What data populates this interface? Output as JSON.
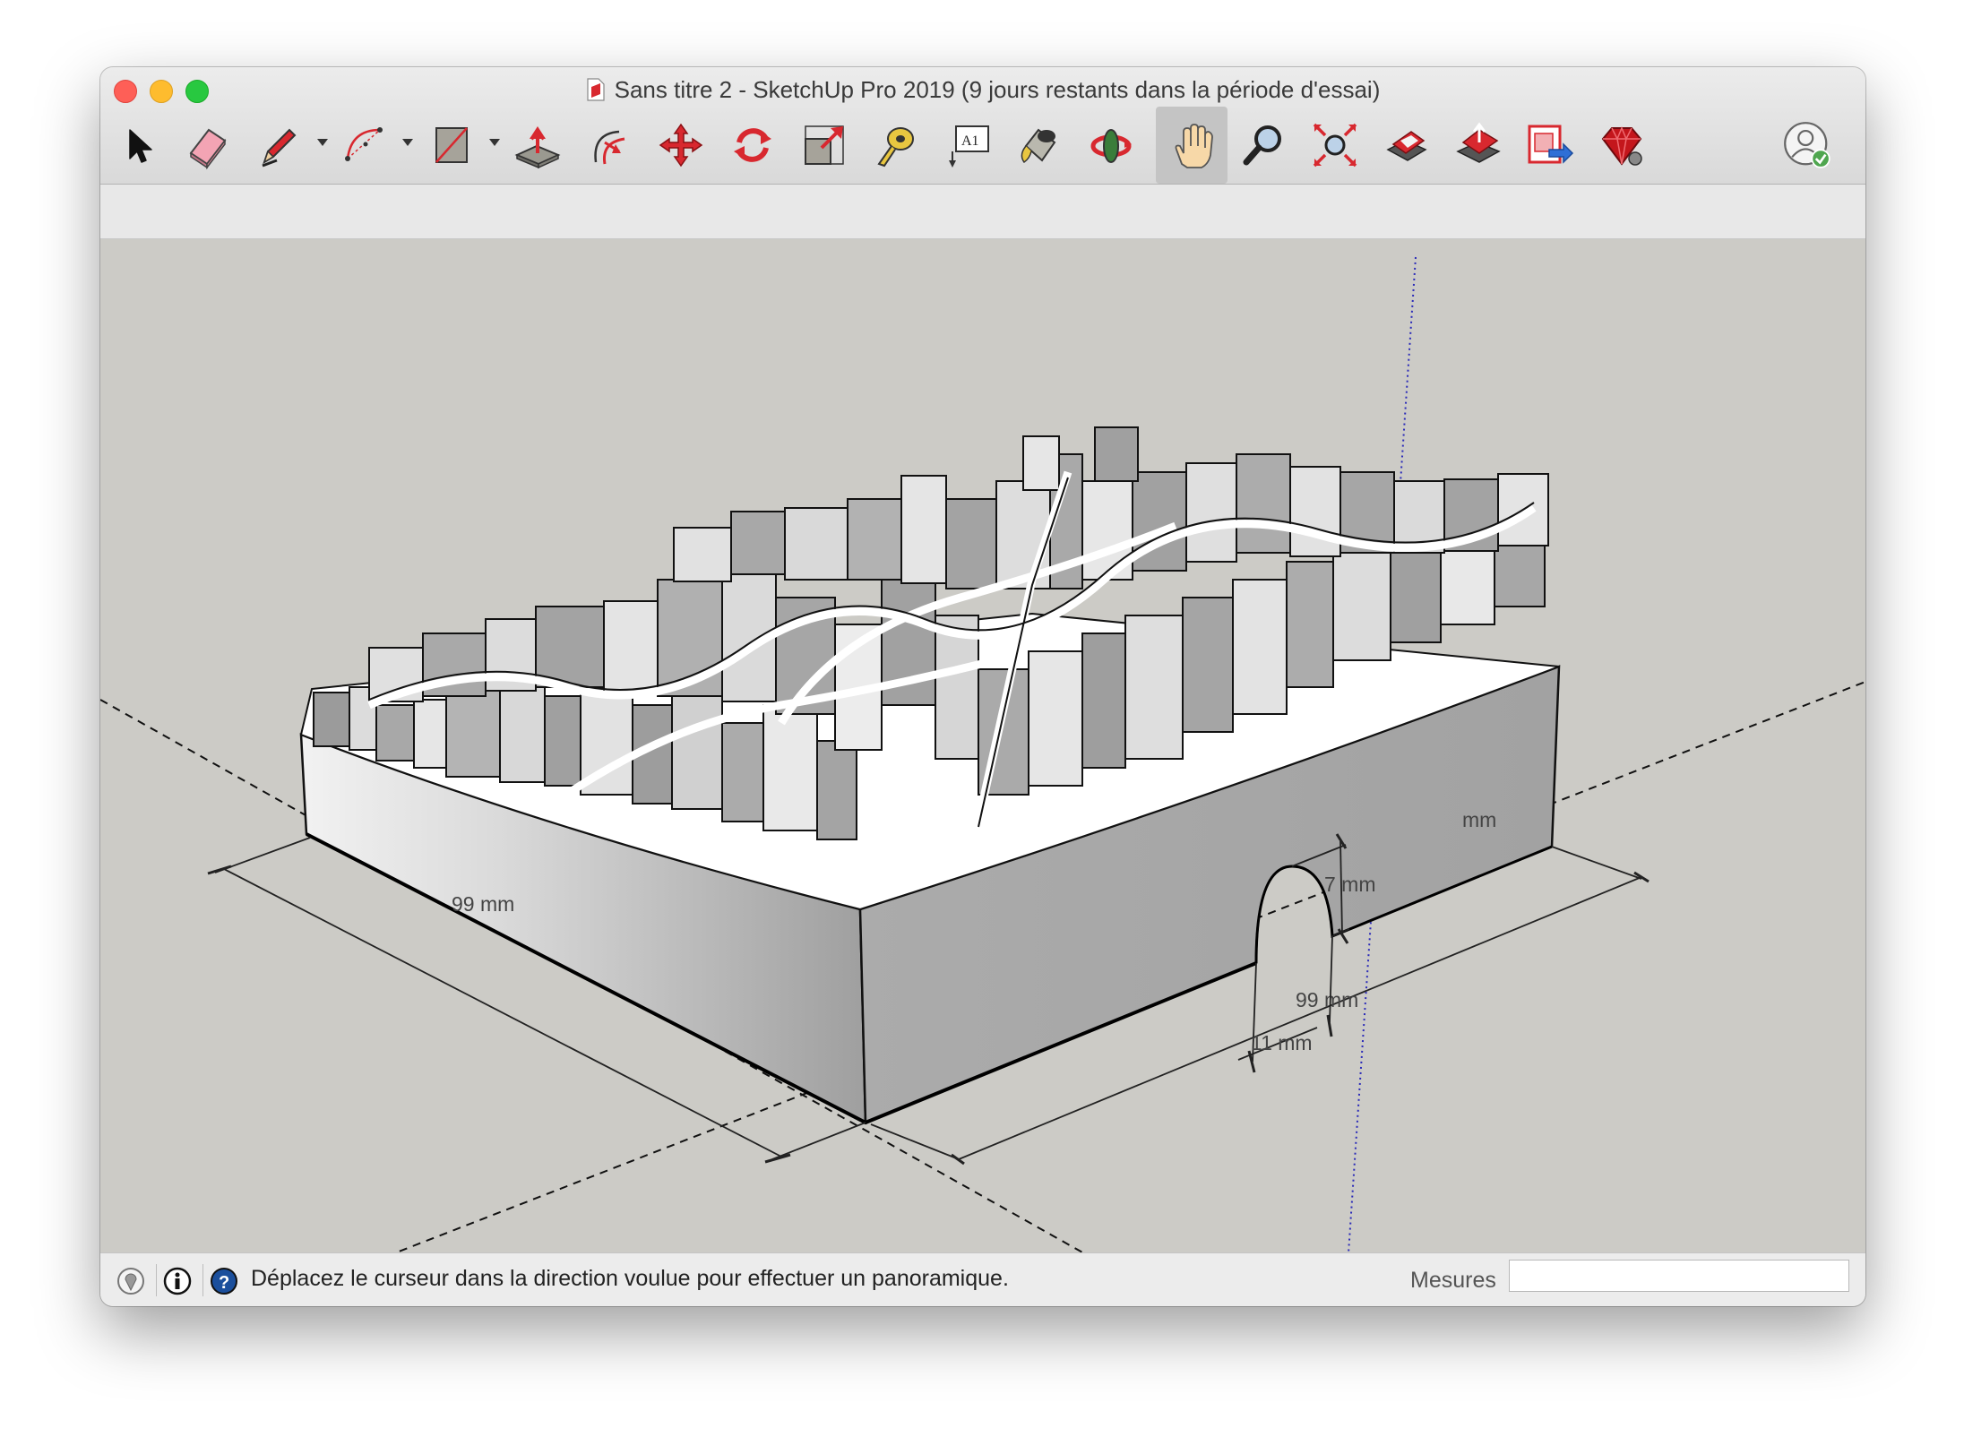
{
  "window": {
    "title": "Sans titre 2 - SketchUp Pro 2019 (9 jours restants dans la période d'essai)"
  },
  "toolbar": {
    "tools": [
      {
        "name": "select-tool",
        "icon": "arrow-cursor-icon"
      },
      {
        "name": "eraser-tool",
        "icon": "eraser-icon"
      },
      {
        "name": "line-tool",
        "icon": "pencil-icon"
      },
      {
        "name": "arc-tool",
        "icon": "arc-icon"
      },
      {
        "name": "rectangle-tool",
        "icon": "rectangle-icon"
      },
      {
        "name": "push-pull-tool",
        "icon": "push-pull-icon"
      },
      {
        "name": "offset-tool",
        "icon": "offset-icon"
      },
      {
        "name": "move-tool",
        "icon": "move-arrows-icon"
      },
      {
        "name": "rotate-tool",
        "icon": "rotate-icon"
      },
      {
        "name": "scale-tool",
        "icon": "scale-icon"
      },
      {
        "name": "tape-measure-tool",
        "icon": "tape-measure-icon"
      },
      {
        "name": "text-tool",
        "icon": "text-a1-icon"
      },
      {
        "name": "paint-bucket-tool",
        "icon": "paint-bucket-icon"
      },
      {
        "name": "orbit-tool",
        "icon": "orbit-icon"
      },
      {
        "name": "pan-tool",
        "icon": "hand-icon",
        "active": true
      },
      {
        "name": "zoom-tool",
        "icon": "magnifier-icon"
      },
      {
        "name": "zoom-extents-tool",
        "icon": "zoom-extents-icon"
      },
      {
        "name": "warehouse-tool",
        "icon": "3d-warehouse-icon"
      },
      {
        "name": "share-model-tool",
        "icon": "share-model-icon"
      },
      {
        "name": "extension-warehouse-tool",
        "icon": "extension-warehouse-icon"
      },
      {
        "name": "extension-manager-tool",
        "icon": "ruby-gem-icon"
      }
    ],
    "text_tool_glyph": "A1",
    "account_icon": "user-account-icon"
  },
  "viewport": {
    "dimensions": [
      {
        "id": "front-width",
        "label": "99 mm"
      },
      {
        "id": "side-depth",
        "label": "99 mm"
      },
      {
        "id": "notch-width",
        "label": "11 mm"
      },
      {
        "id": "notch-height",
        "label": "7 mm"
      },
      {
        "id": "back-partial",
        "label": "mm"
      }
    ]
  },
  "statusbar": {
    "icons": [
      "geolocation-icon",
      "credits-icon",
      "help-icon"
    ],
    "message": "Déplacez le curseur dans la direction voulue pour effectuer un panoramique.",
    "measurements_label": "Mesures",
    "measurements_value": ""
  },
  "colors": {
    "accent_red": "#d8282f",
    "viewport_bg": "#cccbc6",
    "axis_blue": "#2a2ab8"
  }
}
